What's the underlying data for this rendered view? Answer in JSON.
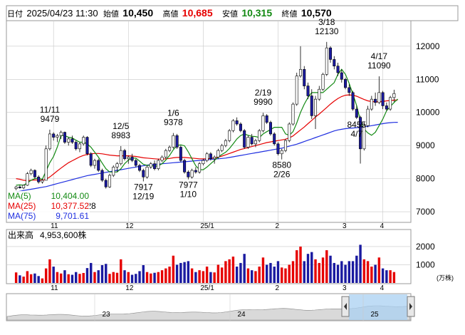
{
  "header": {
    "date_label": "日付",
    "date": "2025/04/23 11:30",
    "open_label": "始値",
    "open": "10,450",
    "high_label": "高値",
    "high": "10,685",
    "low_label": "安値",
    "low": "10,315",
    "close_label": "終値",
    "close": "10,570"
  },
  "colors": {
    "up": "#e60000",
    "down": "#1a1aa0",
    "ma5": "#138a13",
    "ma25": "#e60000",
    "ma75": "#1f2fe0",
    "grid": "#c8c8c8"
  },
  "ma_legend": [
    {
      "label": "MA(5)",
      "value": "10,404.00"
    },
    {
      "label": "MA(25)",
      "value": "10,377.52"
    },
    {
      "label": "MA(75)",
      "value": "9,701.61"
    }
  ],
  "volume_legend": {
    "label": "出来高",
    "value": "4,953,600株"
  },
  "volume_unit": "(万株)",
  "month_labels": [
    "11",
    "12",
    "25/1",
    "2",
    "3",
    "4"
  ],
  "overview_labels": [
    "23",
    "24",
    "25"
  ],
  "chart_data": [
    {
      "type": "candlestick",
      "title": "",
      "y_ticks": [
        7000,
        8000,
        9000,
        10000,
        11000,
        12000
      ],
      "ylim": [
        6700,
        12750
      ],
      "annotations": [
        {
          "text": "11/11",
          "value": 9479
        },
        {
          "text": "12/5",
          "value": 8983
        },
        {
          "text": "1/6",
          "value": 9378
        },
        {
          "text": "2/19",
          "value": 9990
        },
        {
          "text": "3/18",
          "value": 12130
        },
        {
          "text": "4/17",
          "value": 11090
        },
        {
          "text": "12/19",
          "value": 7917
        },
        {
          "text": "1/10",
          "value": 7977
        },
        {
          "text": "2/26",
          "value": 8580
        },
        {
          "text": "4/7",
          "value": 8455
        },
        {
          "text": "28",
          "value": 0
        }
      ],
      "candles": [
        [
          7700,
          7780,
          7650,
          7750
        ],
        [
          7750,
          7800,
          7700,
          7720
        ],
        [
          7720,
          7820,
          7680,
          7800
        ],
        [
          7800,
          8200,
          7780,
          8150
        ],
        [
          8150,
          8300,
          8100,
          8250
        ],
        [
          8250,
          8280,
          8000,
          8050
        ],
        [
          8050,
          8100,
          7850,
          7900
        ],
        [
          7900,
          8000,
          7850,
          7950
        ],
        [
          7950,
          9000,
          7950,
          8900
        ],
        [
          8900,
          9479,
          8850,
          9350
        ],
        [
          9350,
          9400,
          9150,
          9250
        ],
        [
          9250,
          9350,
          9100,
          9300
        ],
        [
          9300,
          9450,
          9200,
          9400
        ],
        [
          9400,
          9420,
          9050,
          9100
        ],
        [
          9100,
          9250,
          9000,
          9200
        ],
        [
          9200,
          9300,
          9050,
          9100
        ],
        [
          9100,
          9150,
          8850,
          8900
        ],
        [
          8900,
          9100,
          8800,
          9050
        ],
        [
          9050,
          9300,
          9000,
          9250
        ],
        [
          9250,
          9280,
          8700,
          8750
        ],
        [
          8750,
          8800,
          8350,
          8400
        ],
        [
          8400,
          8600,
          8300,
          8550
        ],
        [
          8550,
          8600,
          8200,
          8250
        ],
        [
          8250,
          8300,
          7900,
          7950
        ],
        [
          7950,
          8000,
          7700,
          7750
        ],
        [
          7750,
          8150,
          7720,
          8100
        ],
        [
          8100,
          8400,
          8050,
          8350
        ],
        [
          8350,
          8500,
          8200,
          8450
        ],
        [
          8450,
          8983,
          8400,
          8850
        ],
        [
          8850,
          8900,
          8550,
          8600
        ],
        [
          8600,
          8700,
          8450,
          8650
        ],
        [
          8650,
          8750,
          8500,
          8550
        ],
        [
          8550,
          8600,
          8350,
          8400
        ],
        [
          8400,
          8450,
          8200,
          8250
        ],
        [
          8250,
          8300,
          7917,
          8050
        ],
        [
          8050,
          8400,
          8000,
          8350
        ],
        [
          8350,
          8500,
          8300,
          8450
        ],
        [
          8450,
          8550,
          8250,
          8300
        ],
        [
          8300,
          8600,
          8250,
          8550
        ],
        [
          8550,
          8700,
          8500,
          8650
        ],
        [
          8650,
          8900,
          8600,
          8850
        ],
        [
          8850,
          9000,
          8800,
          8950
        ],
        [
          8950,
          9378,
          8900,
          9300
        ],
        [
          9300,
          9350,
          8900,
          8950
        ],
        [
          8950,
          9000,
          8500,
          8550
        ],
        [
          8550,
          8600,
          8150,
          8200
        ],
        [
          8200,
          8250,
          7977,
          8050
        ],
        [
          8050,
          8300,
          8000,
          8250
        ],
        [
          8250,
          8350,
          8150,
          8200
        ],
        [
          8200,
          8500,
          8150,
          8450
        ],
        [
          8450,
          8600,
          8400,
          8550
        ],
        [
          8550,
          8800,
          8500,
          8750
        ],
        [
          8750,
          8800,
          8550,
          8600
        ],
        [
          8600,
          8700,
          8450,
          8650
        ],
        [
          8650,
          8900,
          8600,
          8850
        ],
        [
          8850,
          9050,
          8800,
          9000
        ],
        [
          9000,
          9200,
          8950,
          9150
        ],
        [
          9150,
          9500,
          9100,
          9450
        ],
        [
          9450,
          9800,
          9400,
          9750
        ],
        [
          9750,
          9850,
          9600,
          9650
        ],
        [
          9650,
          9700,
          9400,
          9450
        ],
        [
          9450,
          9500,
          8900,
          8950
        ],
        [
          8950,
          9300,
          8900,
          9250
        ],
        [
          9250,
          9350,
          9000,
          9050
        ],
        [
          9050,
          9200,
          8950,
          9150
        ],
        [
          9150,
          9500,
          9100,
          9450
        ],
        [
          9450,
          9990,
          9400,
          9900
        ],
        [
          9900,
          9950,
          9650,
          9700
        ],
        [
          9700,
          9750,
          9300,
          9350
        ],
        [
          9350,
          9400,
          9000,
          9050
        ],
        [
          9050,
          9100,
          8700,
          8750
        ],
        [
          8750,
          8900,
          8580,
          8850
        ],
        [
          8850,
          9200,
          8800,
          9150
        ],
        [
          9150,
          9700,
          9100,
          9650
        ],
        [
          9650,
          10300,
          9600,
          10250
        ],
        [
          10250,
          11200,
          10200,
          11100
        ],
        [
          11100,
          12000,
          11050,
          11300
        ],
        [
          11300,
          11400,
          10700,
          10800
        ],
        [
          10800,
          10900,
          10400,
          10500
        ],
        [
          10500,
          10700,
          9800,
          9900
        ],
        [
          9900,
          10500,
          9500,
          10400
        ],
        [
          10400,
          10800,
          10350,
          10700
        ],
        [
          10700,
          11200,
          10650,
          11150
        ],
        [
          11150,
          12130,
          11100,
          11950
        ],
        [
          11950,
          12000,
          11500,
          11600
        ],
        [
          11600,
          11700,
          11300,
          11400
        ],
        [
          11400,
          11500,
          11100,
          11200
        ],
        [
          11200,
          11300,
          10900,
          11000
        ],
        [
          11000,
          11050,
          10700,
          10750
        ],
        [
          10750,
          10850,
          10500,
          10600
        ],
        [
          10600,
          10650,
          10050,
          10100
        ],
        [
          10100,
          10200,
          9800,
          9850
        ],
        [
          9850,
          9900,
          8455,
          8900
        ],
        [
          8900,
          9700,
          8850,
          9600
        ],
        [
          9600,
          10200,
          9550,
          10100
        ],
        [
          10100,
          10500,
          10050,
          10400
        ],
        [
          10400,
          10600,
          10200,
          10300
        ],
        [
          10300,
          11090,
          10250,
          10600
        ],
        [
          10600,
          10650,
          10100,
          10200
        ],
        [
          10200,
          10300,
          10050,
          10100
        ],
        [
          10100,
          10500,
          10050,
          10450
        ],
        [
          10450,
          10685,
          10315,
          10570
        ]
      ],
      "ma5": [
        7800,
        7810,
        7800,
        7870,
        7950,
        8000,
        8010,
        7980,
        8230,
        8480,
        8670,
        8950,
        9300,
        9300,
        9250,
        9230,
        9160,
        9100,
        9100,
        9050,
        8950,
        8800,
        8650,
        8470,
        8300,
        8200,
        8200,
        8200,
        8300,
        8450,
        8560,
        8620,
        8620,
        8530,
        8430,
        8400,
        8400,
        8370,
        8390,
        8450,
        8560,
        8700,
        8870,
        9000,
        9020,
        8990,
        8810,
        8600,
        8390,
        8270,
        8270,
        8350,
        8450,
        8550,
        8650,
        8730,
        8800,
        8910,
        9050,
        9200,
        9300,
        9350,
        9310,
        9280,
        9270,
        9240,
        9350,
        9420,
        9480,
        9550,
        9550,
        9550,
        9350,
        9310,
        9420,
        9680,
        10000,
        10250,
        10450,
        10600,
        10600,
        10600,
        10600,
        10700,
        10800,
        10900,
        11150,
        11300,
        11150,
        10880,
        10550,
        10210,
        9760,
        9500,
        9380,
        9310,
        9400,
        9600,
        9800,
        10050,
        10180,
        10300,
        10404
      ],
      "ma25": [
        8000,
        7980,
        7950,
        7940,
        7950,
        7960,
        7960,
        7950,
        7980,
        8050,
        8140,
        8230,
        8320,
        8400,
        8480,
        8540,
        8600,
        8660,
        8700,
        8730,
        8750,
        8760,
        8760,
        8750,
        8730,
        8710,
        8700,
        8690,
        8690,
        8690,
        8690,
        8680,
        8670,
        8650,
        8630,
        8620,
        8610,
        8600,
        8590,
        8590,
        8600,
        8610,
        8630,
        8640,
        8640,
        8640,
        8630,
        8620,
        8610,
        8600,
        8600,
        8600,
        8610,
        8630,
        8650,
        8680,
        8720,
        8760,
        8800,
        8840,
        8880,
        8910,
        8940,
        8970,
        9000,
        9030,
        9060,
        9090,
        9110,
        9130,
        9150,
        9170,
        9190,
        9230,
        9290,
        9380,
        9470,
        9560,
        9660,
        9760,
        9860,
        9950,
        10050,
        10150,
        10250,
        10340,
        10420,
        10480,
        10520,
        10530,
        10520,
        10490,
        10440,
        10390,
        10350,
        10330,
        10320,
        10320,
        10330,
        10350,
        10360,
        10370,
        10378
      ],
      "ma75": [
        7600,
        7620,
        7640,
        7660,
        7680,
        7700,
        7720,
        7740,
        7760,
        7790,
        7820,
        7850,
        7880,
        7910,
        7940,
        7970,
        8000,
        8030,
        8060,
        8090,
        8110,
        8130,
        8150,
        8170,
        8190,
        8210,
        8230,
        8250,
        8270,
        8290,
        8310,
        8330,
        8350,
        8370,
        8390,
        8410,
        8420,
        8430,
        8440,
        8450,
        8460,
        8470,
        8480,
        8490,
        8500,
        8510,
        8520,
        8530,
        8540,
        8550,
        8560,
        8570,
        8580,
        8590,
        8600,
        8610,
        8620,
        8640,
        8660,
        8680,
        8700,
        8720,
        8740,
        8760,
        8780,
        8800,
        8820,
        8840,
        8860,
        8880,
        8900,
        8920,
        8950,
        8980,
        9010,
        9040,
        9080,
        9120,
        9160,
        9200,
        9240,
        9280,
        9320,
        9360,
        9400,
        9440,
        9470,
        9490,
        9510,
        9520,
        9530,
        9540,
        9550,
        9560,
        9580,
        9600,
        9620,
        9640,
        9660,
        9680,
        9690,
        9700,
        9702
      ]
    },
    {
      "type": "bar",
      "title": "",
      "y_ticks": [
        1000,
        2000
      ],
      "ylim": [
        0,
        2900
      ],
      "values": [
        580,
        420,
        350,
        650,
        480,
        520,
        380,
        250,
        800,
        1300,
        900,
        600,
        520,
        700,
        480,
        450,
        600,
        500,
        550,
        820,
        1100,
        600,
        700,
        980,
        1050,
        500,
        600,
        560,
        1300,
        700,
        600,
        450,
        500,
        650,
        980,
        600,
        520,
        560,
        600,
        700,
        800,
        900,
        1500,
        1000,
        1100,
        1150,
        1200,
        800,
        600,
        700,
        650,
        900,
        600,
        580,
        1000,
        850,
        1200,
        1300,
        1450,
        900,
        1100,
        1600,
        800,
        700,
        650,
        900,
        1400,
        1000,
        1100,
        900,
        1200,
        850,
        800,
        1000,
        1200,
        1800,
        2000,
        1200,
        1600,
        1700,
        1300,
        1100,
        1400,
        1800,
        1500,
        1100,
        1000,
        1200,
        1000,
        1200,
        1200,
        1500,
        2100,
        1300,
        1200,
        900,
        1000,
        1400,
        800,
        700,
        700,
        600,
        495
      ]
    }
  ]
}
